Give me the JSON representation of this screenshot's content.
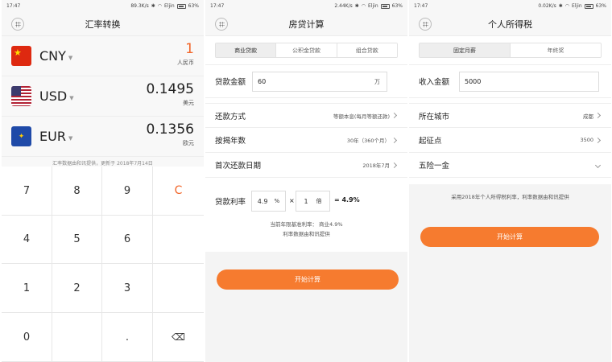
{
  "colors": {
    "accent": "#f67b2f",
    "orange_text": "#f2662a"
  },
  "screen1": {
    "status": {
      "time": "17:47",
      "speed": "89.3K/s",
      "carrier": "Eljin",
      "battery": "63%"
    },
    "title": "汇率转换",
    "currencies": [
      {
        "code": "CNY",
        "amount": "1",
        "name": "人民币",
        "flag": "china-flag-icon"
      },
      {
        "code": "USD",
        "amount": "0.1495",
        "name": "美元",
        "flag": "usa-flag-icon"
      },
      {
        "code": "EUR",
        "amount": "0.1356",
        "name": "欧元",
        "flag": "eu-flag-icon"
      }
    ],
    "note": "汇率数据由和讯提供，更新于 2018年7月14日",
    "keys": [
      "7",
      "8",
      "9",
      "C",
      "4",
      "5",
      "6",
      "",
      "1",
      "2",
      "3",
      "",
      "0",
      "",
      ".",
      "backspace-icon"
    ]
  },
  "screen2": {
    "status": {
      "time": "17:47",
      "speed": "2.44K/s",
      "carrier": "Eljin",
      "battery": "63%"
    },
    "title": "房贷计算",
    "tabs": [
      "商业贷款",
      "公积金贷款",
      "组合贷款"
    ],
    "loan_amount_label": "贷款金额",
    "loan_amount_value": "60",
    "loan_amount_unit": "万",
    "rows": [
      {
        "label": "还款方式",
        "value": "等额本息(每月等额还款)"
      },
      {
        "label": "按揭年数",
        "value": "30年（360个月）"
      },
      {
        "label": "首次还款日期",
        "value": "2018年7月"
      }
    ],
    "rate_label": "贷款利率",
    "rate_value": "4.9",
    "rate_unit": "%",
    "times_sign": "×",
    "multiplier_value": "1",
    "multiplier_unit": "倍",
    "rate_result": "= 4.9%",
    "info_line1": "当前年限基准利率：  商业4.9%",
    "info_line2": "利率数据由和讯提供",
    "button": "开始计算"
  },
  "screen3": {
    "status": {
      "time": "17:47",
      "speed": "0.02K/s",
      "carrier": "Eljin",
      "battery": "63%"
    },
    "title": "个人所得税",
    "tabs": [
      "固定月薪",
      "年终奖"
    ],
    "income_label": "收入金额",
    "income_value": "5000",
    "rows": [
      {
        "label": "所在城市",
        "value": "成都"
      },
      {
        "label": "起征点",
        "value": "3500"
      },
      {
        "label": "五险一金",
        "value": ""
      }
    ],
    "info": "采用2018年个人所得税利率，利率数据由和讯提供",
    "button": "开始计算"
  }
}
